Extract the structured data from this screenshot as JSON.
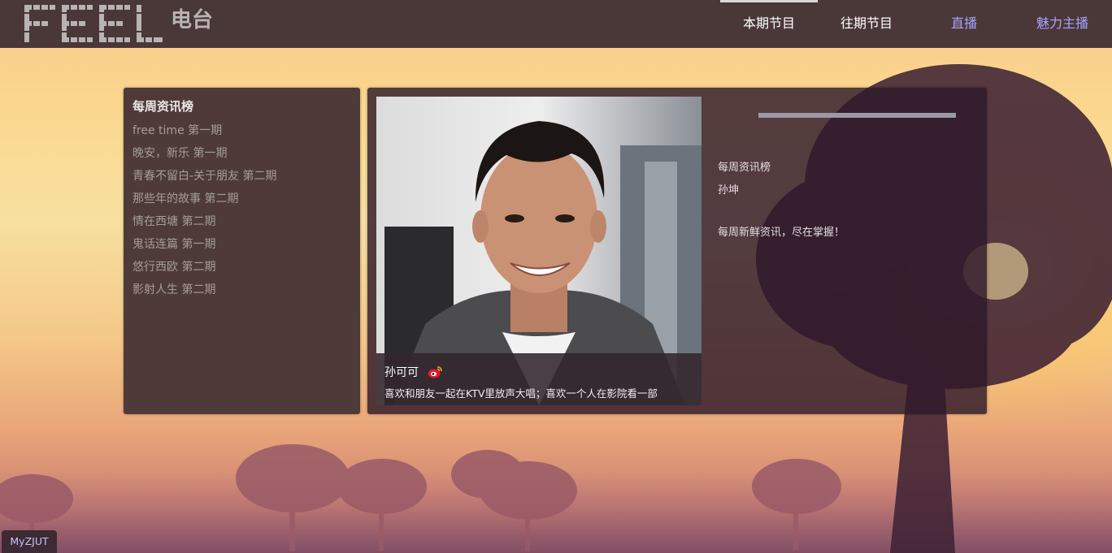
{
  "header": {
    "logo_text": "FEEL",
    "logo_sub": "电台",
    "nav": [
      {
        "label": "本期节目",
        "color": "#ffffff",
        "active": true
      },
      {
        "label": "往期节目",
        "color": "#ffffff",
        "active": false
      },
      {
        "label": "直播",
        "color": "#a9a3ff",
        "active": false
      },
      {
        "label": "魅力主播",
        "color": "#a9a3ff",
        "active": false
      }
    ]
  },
  "sidebar": {
    "title": "每周资讯榜",
    "items": [
      {
        "label": "free time 第一期"
      },
      {
        "label": "晚安，新乐 第一期"
      },
      {
        "label": "青春不留白-关于朋友 第二期"
      },
      {
        "label": "那些年的故事 第二期"
      },
      {
        "label": "情在西塘 第二期"
      },
      {
        "label": "鬼话连篇 第一期"
      },
      {
        "label": "悠行西欧 第二期"
      },
      {
        "label": "影射人生 第二期"
      }
    ]
  },
  "host": {
    "name": "孙可可",
    "weibo_icon": "weibo-icon",
    "description": "喜欢和朋友一起在KTV里放声大唱；喜欢一个人在影院看一部"
  },
  "program": {
    "title": "每周资讯榜",
    "host": "孙坤",
    "summary": "每周新鲜资讯，尽在掌握！"
  },
  "footer": {
    "myzjut": "MyZJUT"
  },
  "colors": {
    "header_bg": "#4a3738",
    "panel_bg": "#483636",
    "accent_nav": "#a9a3ff"
  }
}
